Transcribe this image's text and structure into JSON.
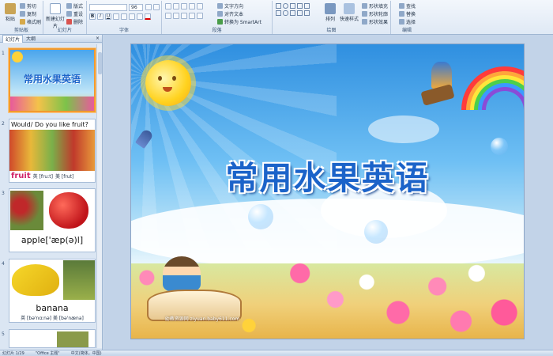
{
  "ribbon": {
    "clipboard": {
      "paste": "粘贴",
      "cut": "剪切",
      "copy": "复制",
      "format_painter": "格式刷",
      "label": "剪贴板"
    },
    "slides": {
      "new_slide": "新建幻灯片",
      "layout": "版式",
      "reset": "重设",
      "delete": "删除",
      "label": "幻灯片"
    },
    "font": {
      "font_size": "96",
      "label": "字体"
    },
    "paragraph": {
      "text_direction": "文字方向",
      "align_text": "对齐文本",
      "convert_smartart": "转换为 SmartArt",
      "label": "段落"
    },
    "drawing": {
      "arrange": "排列",
      "quick_styles": "快速样式",
      "shape_fill": "形状填充",
      "shape_outline": "形状轮廓",
      "shape_effects": "形状效果",
      "label": "绘图"
    },
    "editing": {
      "find": "查找",
      "replace": "替换",
      "select": "选择",
      "label": "编辑"
    }
  },
  "pane": {
    "tab_slides": "幻灯片",
    "tab_outline": "大纲",
    "close": "×",
    "slides": [
      {
        "num": "1",
        "title": "常用水果英语"
      },
      {
        "num": "2",
        "heading": "Would/ Do you like fruit?",
        "word": "fruit",
        "phon1": "英 [fruːt]",
        "phon2": "美 [frut]"
      },
      {
        "num": "3",
        "word": "apple['æp(ə)l]"
      },
      {
        "num": "4",
        "word": "banana",
        "phon1": "英 [bə'nɑːnə]",
        "phon2": "美 [bə'næna]"
      },
      {
        "num": "5"
      }
    ]
  },
  "main_slide": {
    "title": "常用水果英语",
    "watermark_site": "幼教资源网 ziyuan.baby611.com"
  },
  "status": {
    "slide_of": "幻灯片 1/29",
    "theme": "\"Office 主题\"",
    "language": "中文(简体，中国)"
  },
  "colors": {
    "title_blue": "#1b63c9",
    "selection_orange": "#f29a2e"
  }
}
